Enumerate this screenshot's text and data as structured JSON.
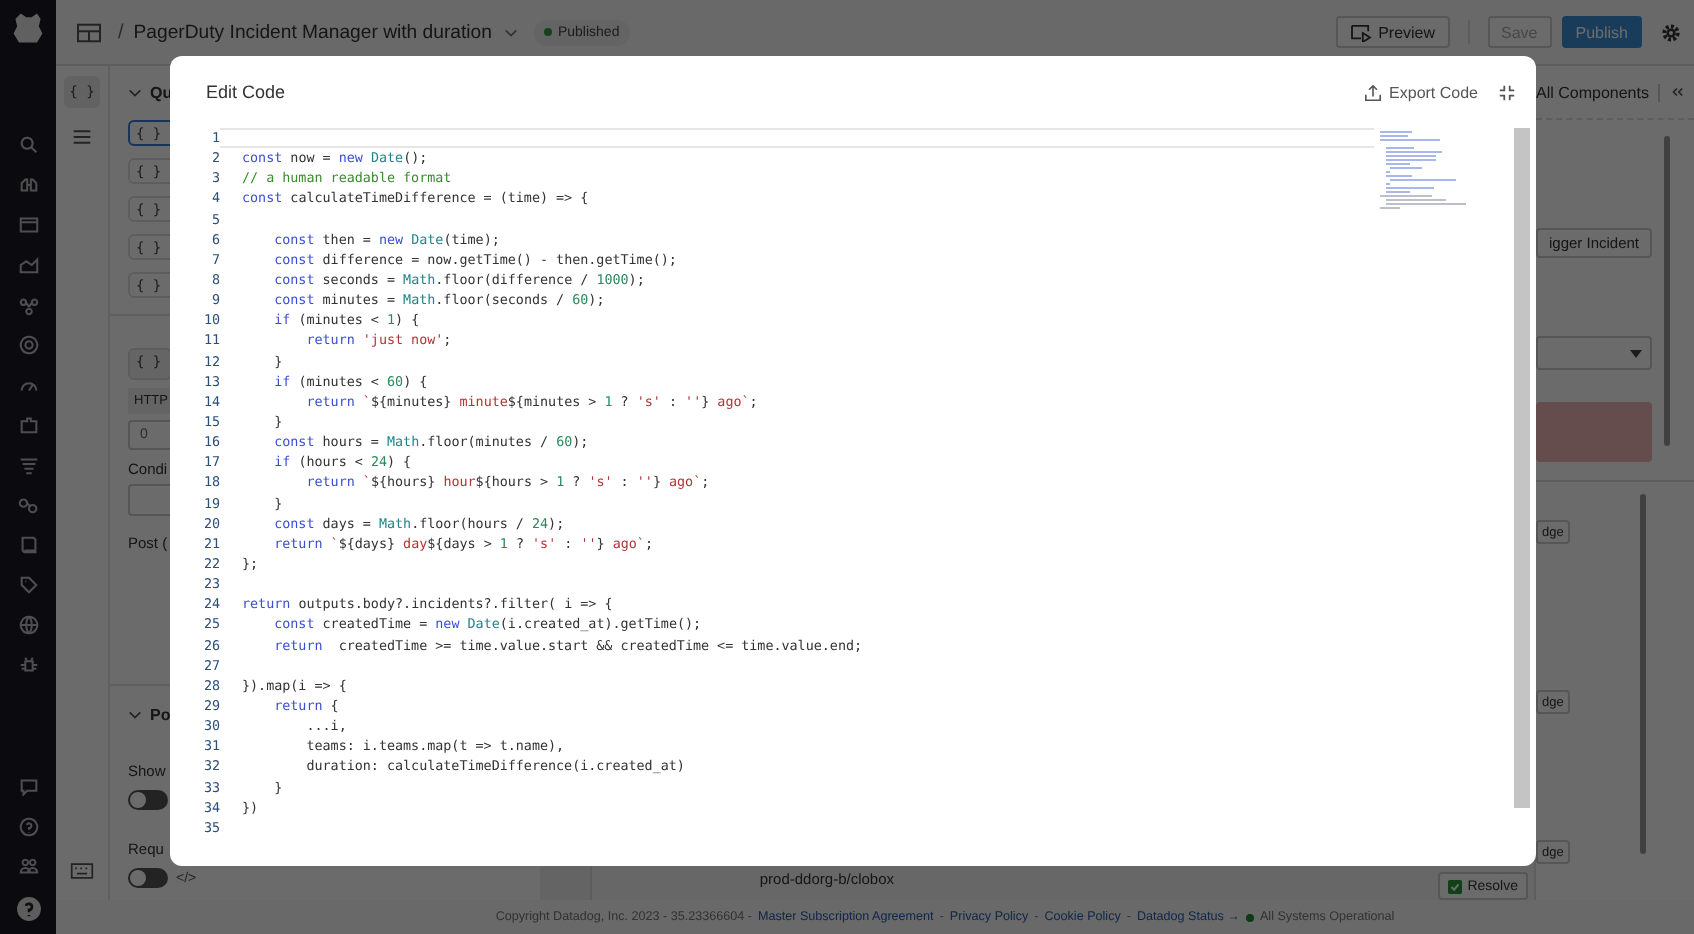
{
  "header": {
    "separator": "/",
    "title": "PagerDuty Incident Manager with duration",
    "status": "Published",
    "buttons": [
      {
        "label": "Preview",
        "kind": "outline"
      },
      {
        "label": "Save",
        "kind": "disabled"
      },
      {
        "label": "Publish",
        "kind": "primary"
      }
    ]
  },
  "rail": {
    "query_button": "{ }"
  },
  "config_panel": {
    "section": "Qu",
    "query_items": [
      {
        "label": "{ }",
        "selected": true
      },
      {
        "label": "{ }",
        "selected": false
      },
      {
        "label": "{ }",
        "selected": false
      },
      {
        "label": "{ }",
        "selected": false
      },
      {
        "label": "{ }",
        "selected": false
      }
    ],
    "query_button": "{ }",
    "http_tag": "HTTP",
    "http_value": "0",
    "condition_label": "Condi",
    "post_label": "Post (",
    "post_section": "Po",
    "show_label": "Show",
    "show_toggle": {
      "on": false
    },
    "require_label": "Requ",
    "require_toggle": {
      "on": false
    },
    "code_toggle": "</>"
  },
  "right_panel": {
    "title": "All Components",
    "trigger_button": "igger Incident",
    "list_buttons": [
      "dge",
      "dge",
      "dge"
    ]
  },
  "table": {
    "cell": "prod-ddorg-b/clobox",
    "resolve_button": "Resolve"
  },
  "footer": [
    {
      "kind": "text",
      "text": "Copyright Datadog, Inc. 2023 - 35.23366604 -"
    },
    {
      "kind": "link",
      "text": "Master Subscription Agreement"
    },
    {
      "kind": "text",
      "text": "-"
    },
    {
      "kind": "link",
      "text": "Privacy Policy"
    },
    {
      "kind": "text",
      "text": "-"
    },
    {
      "kind": "link",
      "text": "Cookie Policy"
    },
    {
      "kind": "text",
      "text": "-"
    },
    {
      "kind": "link",
      "text": "Datadog Status →"
    },
    {
      "kind": "status",
      "text": "All Systems Operational"
    }
  ],
  "modal": {
    "title": "Edit Code",
    "export": "Export Code",
    "lines": [
      {
        "n": "1",
        "current": true
      },
      {
        "n": "2",
        "current": false,
        "t": [
          {
            "kind": "keyword",
            "text": "const"
          },
          {
            "kind": "plain",
            "text": " now = "
          },
          {
            "kind": "keyword",
            "text": "new"
          },
          {
            "kind": "builtin",
            "text": " Date"
          },
          {
            "kind": "plain",
            "text": "();"
          }
        ]
      },
      {
        "n": "3",
        "current": false,
        "t": [
          {
            "kind": "comment",
            "text": "// a human readable format"
          }
        ]
      },
      {
        "n": "4",
        "current": false,
        "t": [
          {
            "kind": "keyword",
            "text": "const"
          },
          {
            "kind": "plain",
            "text": " calculateTimeDifference = (time) => {"
          }
        ]
      },
      {
        "n": "5",
        "current": false
      },
      {
        "n": "6",
        "current": false,
        "t": [
          {
            "kind": "keyword",
            "text": "    const"
          },
          {
            "kind": "plain",
            "text": " then = "
          },
          {
            "kind": "keyword",
            "text": "new"
          },
          {
            "kind": "builtin",
            "text": " Date"
          },
          {
            "kind": "plain",
            "text": "(time);"
          }
        ]
      },
      {
        "n": "7",
        "current": false,
        "t": [
          {
            "kind": "keyword",
            "text": "    const"
          },
          {
            "kind": "plain",
            "text": " difference = now.getTime() - then.getTime();"
          }
        ]
      },
      {
        "n": "8",
        "current": false,
        "t": [
          {
            "kind": "keyword",
            "text": "    const"
          },
          {
            "kind": "plain",
            "text": " seconds = "
          },
          {
            "kind": "builtin",
            "text": "Math"
          },
          {
            "kind": "plain",
            "text": ".floor(difference / "
          },
          {
            "kind": "number",
            "text": "1000"
          },
          {
            "kind": "plain",
            "text": ");"
          }
        ]
      },
      {
        "n": "9",
        "current": false,
        "t": [
          {
            "kind": "keyword",
            "text": "    const"
          },
          {
            "kind": "plain",
            "text": " minutes = "
          },
          {
            "kind": "builtin",
            "text": "Math"
          },
          {
            "kind": "plain",
            "text": ".floor(seconds / "
          },
          {
            "kind": "number",
            "text": "60"
          },
          {
            "kind": "plain",
            "text": ");"
          }
        ]
      },
      {
        "n": "10",
        "current": false,
        "t": [
          {
            "kind": "keyword",
            "text": "    if"
          },
          {
            "kind": "plain",
            "text": " (minutes < "
          },
          {
            "kind": "number",
            "text": "1"
          },
          {
            "kind": "plain",
            "text": ") {"
          }
        ]
      },
      {
        "n": "11",
        "current": false,
        "t": [
          {
            "kind": "keyword",
            "text": "        return"
          },
          {
            "kind": "string",
            "text": " 'just now'"
          },
          {
            "kind": "plain",
            "text": ";"
          }
        ]
      },
      {
        "n": "12",
        "current": false,
        "t": [
          {
            "kind": "plain",
            "text": "    }"
          }
        ]
      },
      {
        "n": "13",
        "current": false,
        "t": [
          {
            "kind": "keyword",
            "text": "    if"
          },
          {
            "kind": "plain",
            "text": " (minutes < "
          },
          {
            "kind": "number",
            "text": "60"
          },
          {
            "kind": "plain",
            "text": ") {"
          }
        ]
      },
      {
        "n": "14",
        "current": false,
        "t": [
          {
            "kind": "keyword",
            "text": "        return"
          },
          {
            "kind": "string",
            "text": " `"
          },
          {
            "kind": "plain",
            "text": "${minutes} "
          },
          {
            "kind": "string",
            "text": "minute"
          },
          {
            "kind": "plain",
            "text": "${minutes > "
          },
          {
            "kind": "number",
            "text": "1"
          },
          {
            "kind": "plain",
            "text": " ? "
          },
          {
            "kind": "string",
            "text": "'s'"
          },
          {
            "kind": "plain",
            "text": " : "
          },
          {
            "kind": "string",
            "text": "''"
          },
          {
            "kind": "plain",
            "text": "} "
          },
          {
            "kind": "string",
            "text": "ago`"
          },
          {
            "kind": "plain",
            "text": ";"
          }
        ]
      },
      {
        "n": "15",
        "current": false,
        "t": [
          {
            "kind": "plain",
            "text": "    }"
          }
        ]
      },
      {
        "n": "16",
        "current": false,
        "t": [
          {
            "kind": "keyword",
            "text": "    const"
          },
          {
            "kind": "plain",
            "text": " hours = "
          },
          {
            "kind": "builtin",
            "text": "Math"
          },
          {
            "kind": "plain",
            "text": ".floor(minutes / "
          },
          {
            "kind": "number",
            "text": "60"
          },
          {
            "kind": "plain",
            "text": ");"
          }
        ]
      },
      {
        "n": "17",
        "current": false,
        "t": [
          {
            "kind": "keyword",
            "text": "    if"
          },
          {
            "kind": "plain",
            "text": " (hours < "
          },
          {
            "kind": "number",
            "text": "24"
          },
          {
            "kind": "plain",
            "text": ") {"
          }
        ]
      },
      {
        "n": "18",
        "current": false,
        "t": [
          {
            "kind": "keyword",
            "text": "        return"
          },
          {
            "kind": "string",
            "text": " `"
          },
          {
            "kind": "plain",
            "text": "${hours} "
          },
          {
            "kind": "string",
            "text": "hour"
          },
          {
            "kind": "plain",
            "text": "${hours > "
          },
          {
            "kind": "number",
            "text": "1"
          },
          {
            "kind": "plain",
            "text": " ? "
          },
          {
            "kind": "string",
            "text": "'s'"
          },
          {
            "kind": "plain",
            "text": " : "
          },
          {
            "kind": "string",
            "text": "''"
          },
          {
            "kind": "plain",
            "text": "} "
          },
          {
            "kind": "string",
            "text": "ago`"
          },
          {
            "kind": "plain",
            "text": ";"
          }
        ]
      },
      {
        "n": "19",
        "current": false,
        "t": [
          {
            "kind": "plain",
            "text": "    }"
          }
        ]
      },
      {
        "n": "20",
        "current": false,
        "t": [
          {
            "kind": "keyword",
            "text": "    const"
          },
          {
            "kind": "plain",
            "text": " days = "
          },
          {
            "kind": "builtin",
            "text": "Math"
          },
          {
            "kind": "plain",
            "text": ".floor(hours / "
          },
          {
            "kind": "number",
            "text": "24"
          },
          {
            "kind": "plain",
            "text": ");"
          }
        ]
      },
      {
        "n": "21",
        "current": false,
        "t": [
          {
            "kind": "keyword",
            "text": "    return"
          },
          {
            "kind": "string",
            "text": " `"
          },
          {
            "kind": "plain",
            "text": "${days} "
          },
          {
            "kind": "string",
            "text": "day"
          },
          {
            "kind": "plain",
            "text": "${days > "
          },
          {
            "kind": "number",
            "text": "1"
          },
          {
            "kind": "plain",
            "text": " ? "
          },
          {
            "kind": "string",
            "text": "'s'"
          },
          {
            "kind": "plain",
            "text": " : "
          },
          {
            "kind": "string",
            "text": "''"
          },
          {
            "kind": "plain",
            "text": "} "
          },
          {
            "kind": "string",
            "text": "ago`"
          },
          {
            "kind": "plain",
            "text": ";"
          }
        ]
      },
      {
        "n": "22",
        "current": false,
        "t": [
          {
            "kind": "plain",
            "text": "};"
          }
        ]
      },
      {
        "n": "23",
        "current": false
      },
      {
        "n": "24",
        "current": false,
        "t": [
          {
            "kind": "keyword",
            "text": "return"
          },
          {
            "kind": "plain",
            "text": " outputs.body?.incidents?.filter( i => {"
          }
        ]
      },
      {
        "n": "25",
        "current": false,
        "t": [
          {
            "kind": "keyword",
            "text": "    const"
          },
          {
            "kind": "plain",
            "text": " createdTime = "
          },
          {
            "kind": "keyword",
            "text": "new"
          },
          {
            "kind": "builtin",
            "text": " Date"
          },
          {
            "kind": "plain",
            "text": "(i.created_at).getTime();"
          }
        ]
      },
      {
        "n": "26",
        "current": false,
        "t": [
          {
            "kind": "keyword",
            "text": "    return"
          },
          {
            "kind": "plain",
            "text": "  createdTime >= time.value.start && createdTime <= time.value.end;"
          }
        ]
      },
      {
        "n": "27",
        "current": false
      },
      {
        "n": "28",
        "current": false,
        "t": [
          {
            "kind": "plain",
            "text": "}).map(i => {"
          }
        ]
      },
      {
        "n": "29",
        "current": false,
        "t": [
          {
            "kind": "keyword",
            "text": "    return"
          },
          {
            "kind": "plain",
            "text": " {"
          }
        ]
      },
      {
        "n": "30",
        "current": false,
        "t": [
          {
            "kind": "plain",
            "text": "        ...i,"
          }
        ]
      },
      {
        "n": "31",
        "current": false,
        "t": [
          {
            "kind": "plain",
            "text": "        teams: i.teams.map(t => t.name),"
          }
        ]
      },
      {
        "n": "32",
        "current": false,
        "t": [
          {
            "kind": "plain",
            "text": "        duration: calculateTimeDifference(i.created_at)"
          }
        ]
      },
      {
        "n": "33",
        "current": false,
        "t": [
          {
            "kind": "plain",
            "text": "    }"
          }
        ]
      },
      {
        "n": "34",
        "current": false,
        "t": [
          {
            "kind": "plain",
            "text": "})"
          }
        ]
      },
      {
        "n": "35",
        "current": false
      }
    ]
  }
}
